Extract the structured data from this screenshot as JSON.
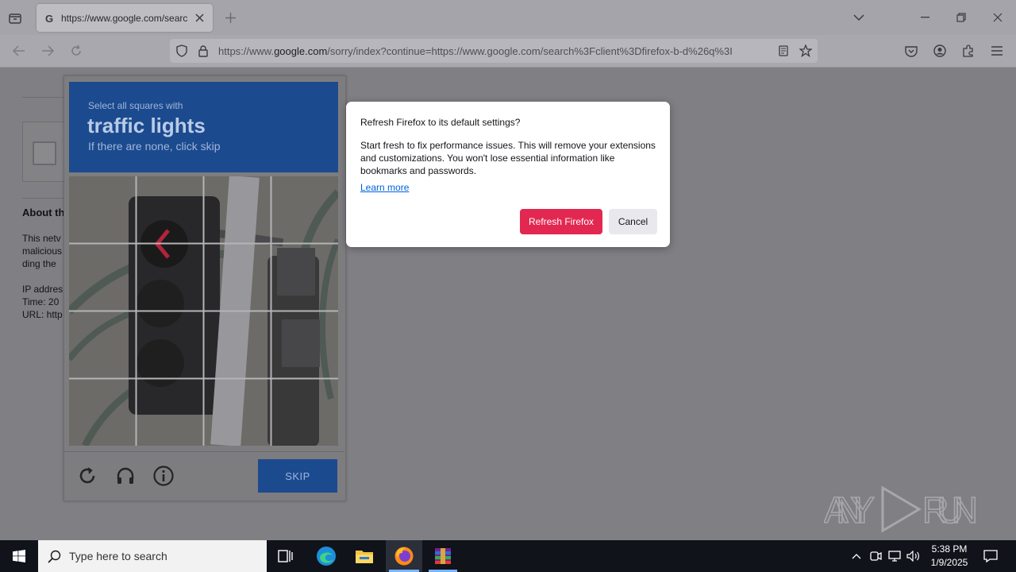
{
  "browser": {
    "tab_title": "https://www.google.com/searc",
    "url_prefix": "https://www.",
    "url_domain": "google.com",
    "url_rest": "/sorry/index?continue=https://www.google.com/search%3Fclient%3Dfirefox-b-d%26q%3I"
  },
  "page_text": {
    "about_heading": "About th",
    "lines": [
      "This netv",
      "malicious",
      "ding the",
      "IP addres",
      "Time: 20",
      "URL: http"
    ]
  },
  "captcha": {
    "instruction_small": "Select all squares with",
    "instruction_big": "traffic lights",
    "instruction_sub": "If there are none, click skip",
    "skip_label": "SKIP"
  },
  "modal": {
    "title": "Refresh Firefox to its default settings?",
    "body": "Start fresh to fix performance issues. This will remove your extensions and customizations. You won't lose essential information like bookmarks and passwords.",
    "learn_more": "Learn more",
    "primary_button": "Refresh Firefox",
    "cancel_button": "Cancel",
    "primary_color": "#e22850"
  },
  "watermark": "ANY RUN",
  "taskbar": {
    "search_placeholder": "Type here to search",
    "time": "5:38 PM",
    "date": "1/9/2025"
  }
}
